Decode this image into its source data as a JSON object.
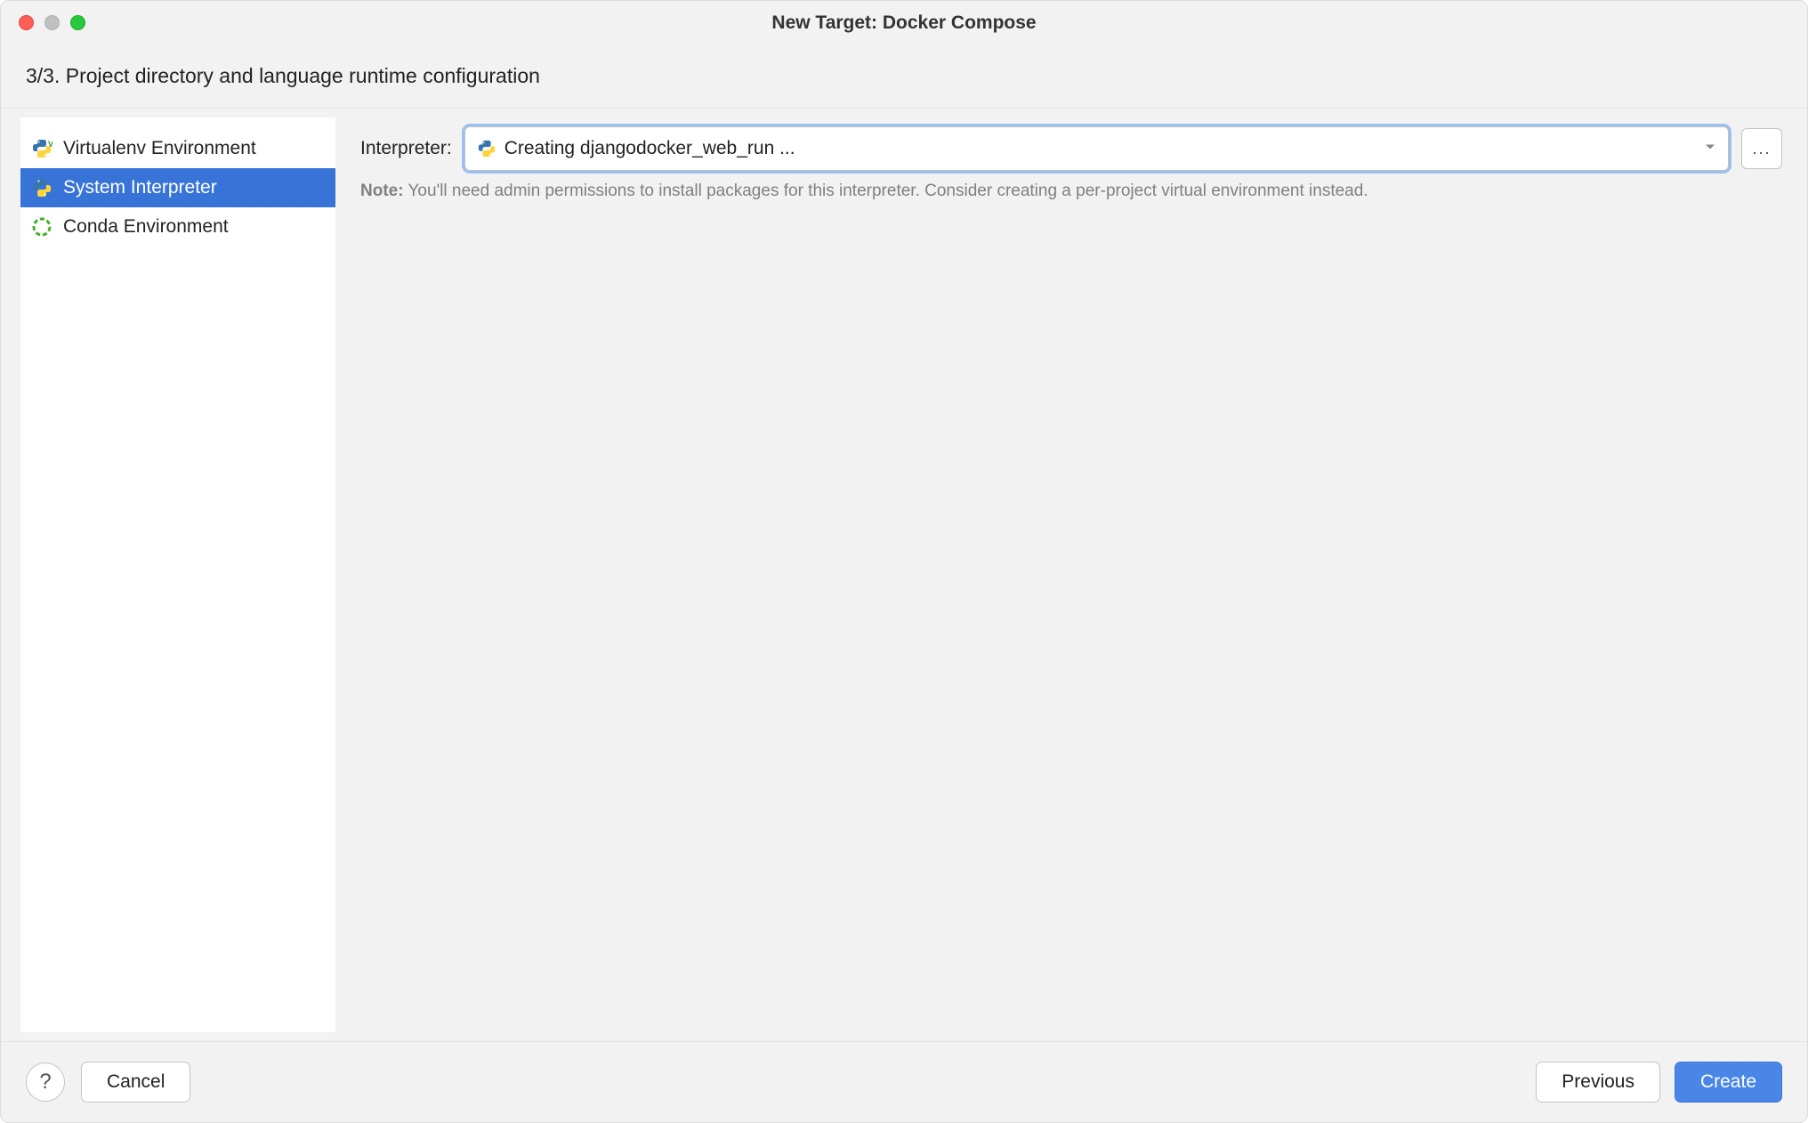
{
  "window": {
    "title": "New Target: Docker Compose"
  },
  "subheader": "3/3. Project directory and language runtime configuration",
  "sidebar": {
    "items": [
      {
        "label": "Virtualenv Environment",
        "icon": "python-venv",
        "selected": false
      },
      {
        "label": "System Interpreter",
        "icon": "python",
        "selected": true
      },
      {
        "label": "Conda Environment",
        "icon": "conda",
        "selected": false
      }
    ]
  },
  "main": {
    "interpreter_label": "Interpreter:",
    "interpreter_value": "Creating djangodocker_web_run ...",
    "more_button": "...",
    "note_prefix": "Note:",
    "note_text": "You'll need admin permissions to install packages for this interpreter. Consider creating a per-project virtual environment instead."
  },
  "footer": {
    "help": "?",
    "cancel": "Cancel",
    "previous": "Previous",
    "create": "Create"
  }
}
